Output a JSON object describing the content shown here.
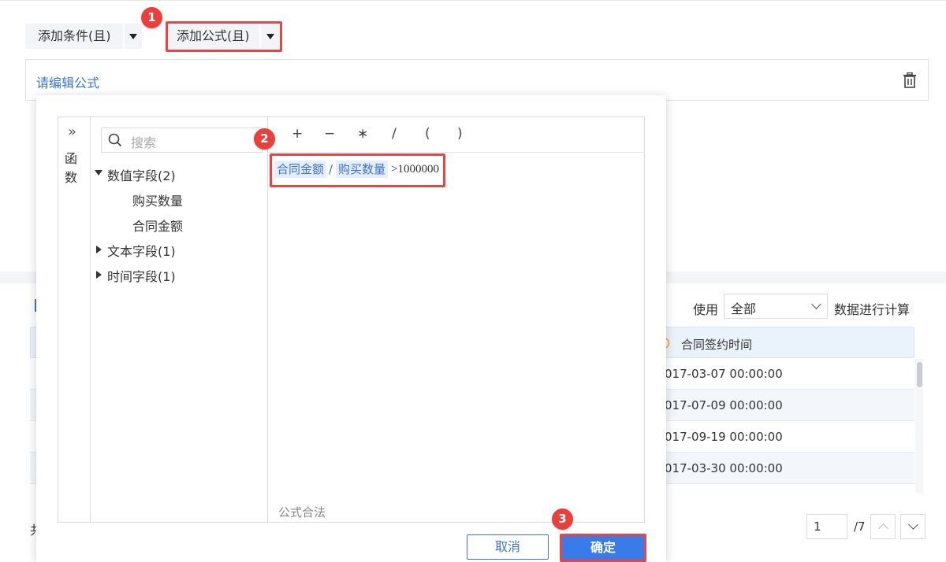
{
  "filter_bar": {
    "add_condition_label": "添加条件(且)",
    "add_formula_label": "添加公式(且)",
    "formula_placeholder": "请编辑公式"
  },
  "badges": [
    "1",
    "2",
    "3"
  ],
  "formula_dialog": {
    "function_tab_label": "函数",
    "search_placeholder": "搜索",
    "field_groups": [
      {
        "label": "数值字段(2)",
        "expanded": true,
        "children": [
          "购买数量",
          "合同金额"
        ]
      },
      {
        "label": "文本字段(1)",
        "expanded": false
      },
      {
        "label": "时间字段(1)",
        "expanded": false
      }
    ],
    "operators": [
      "+",
      "−",
      "∗",
      "/",
      "(",
      ")"
    ],
    "expression": {
      "field1": "合同金额",
      "operator": "/",
      "field2": "购买数量",
      "rest": ">1000000"
    },
    "validation_status": "公式合法",
    "cancel_label": "取消",
    "confirm_label": "确定"
  },
  "data_table": {
    "use_label": "使用",
    "use_select_value": "全部",
    "calc_label": "数据进行计算",
    "column_header": "合同签约时间",
    "rows": [
      "017-03-07 00:00:00",
      "017-07-09 00:00:00",
      "017-09-19 00:00:00",
      "017-03-30 00:00:00"
    ],
    "footer_left_partial": "共"
  },
  "pagination": {
    "current_page": "1",
    "total_pages": "/7"
  },
  "colors": {
    "accent_blue": "#3a74d8",
    "highlight_red": "#e84545",
    "token_bg": "#e6eefa"
  }
}
